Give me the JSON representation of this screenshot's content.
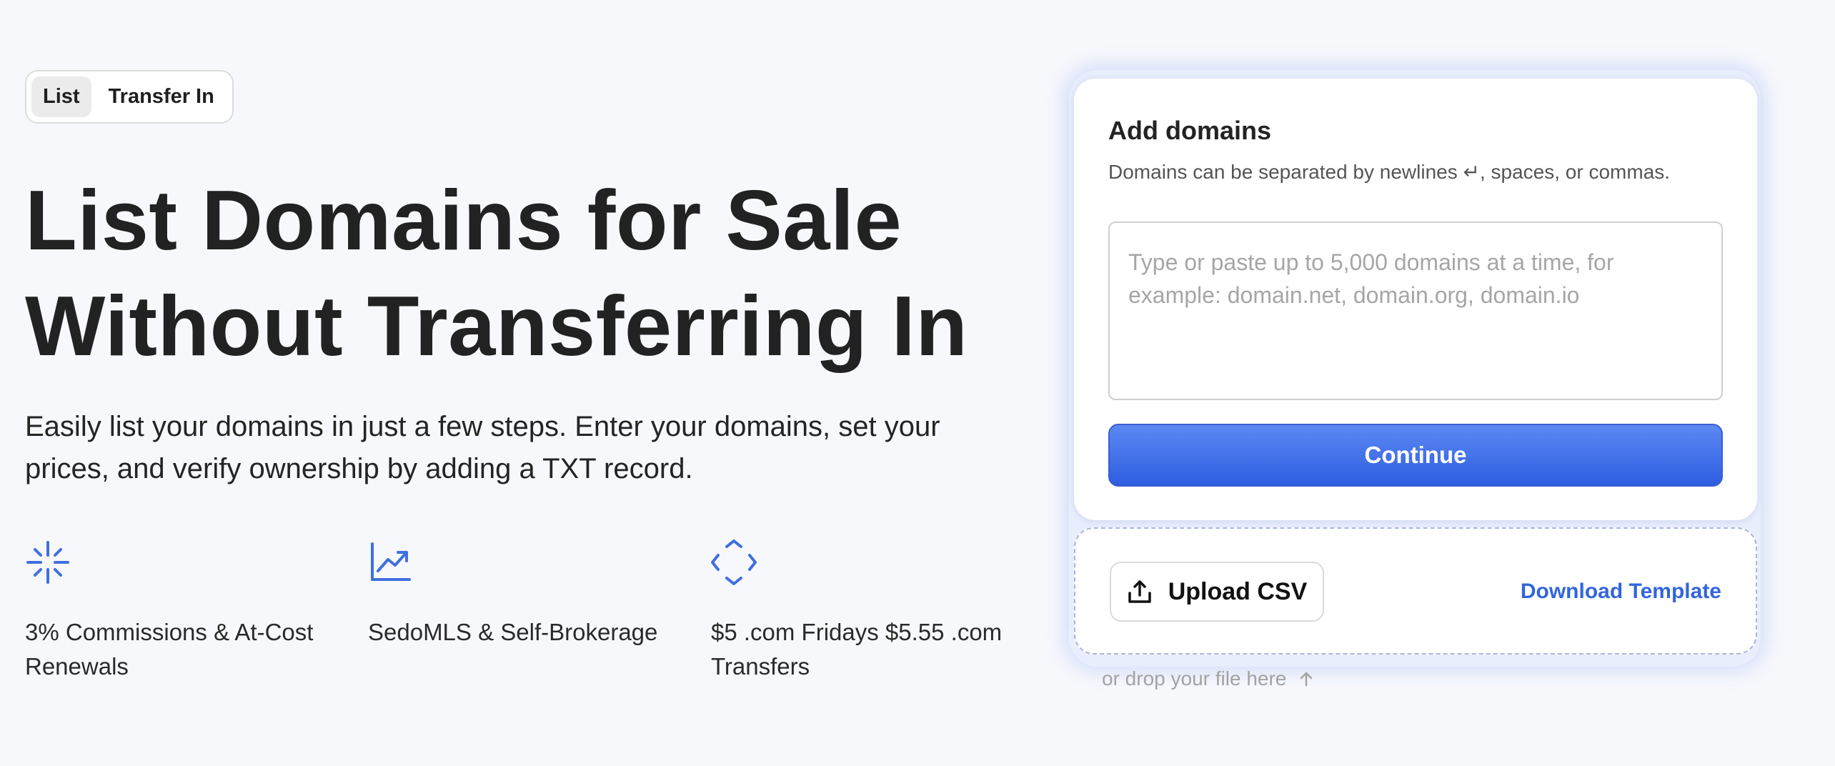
{
  "toggle": {
    "items": [
      {
        "label": "List",
        "active": true
      },
      {
        "label": "Transfer In",
        "active": false
      }
    ]
  },
  "hero": {
    "title_line1": "List Domains for Sale",
    "title_line2": "Without Transferring In",
    "subtitle": "Easily list your domains in just a few steps. Enter your domains, set your prices, and verify ownership by adding a TXT record."
  },
  "features": [
    {
      "icon": "sparkle-icon",
      "text": "3% Commissions & At-Cost Renewals"
    },
    {
      "icon": "trend-chart-icon",
      "text": "SedoMLS & Self-Brokerage"
    },
    {
      "icon": "scan-frame-icon",
      "text": "$5 .com Fridays $5.55 .com Transfers"
    }
  ],
  "add_domains": {
    "title": "Add domains",
    "help": "Domains can be separated by newlines ↵, spaces, or commas.",
    "input_value": "",
    "input_placeholder": "Type or paste up to 5,000 domains at a time, for example: domain.net, domain.org, domain.io",
    "continue_label": "Continue"
  },
  "upload": {
    "button_label": "Upload CSV",
    "download_label": "Download Template",
    "drop_hint": "or drop your file here"
  },
  "colors": {
    "accent": "#3366dd",
    "icon_blue": "#3f6fe0",
    "background": "#f7f8fc"
  }
}
